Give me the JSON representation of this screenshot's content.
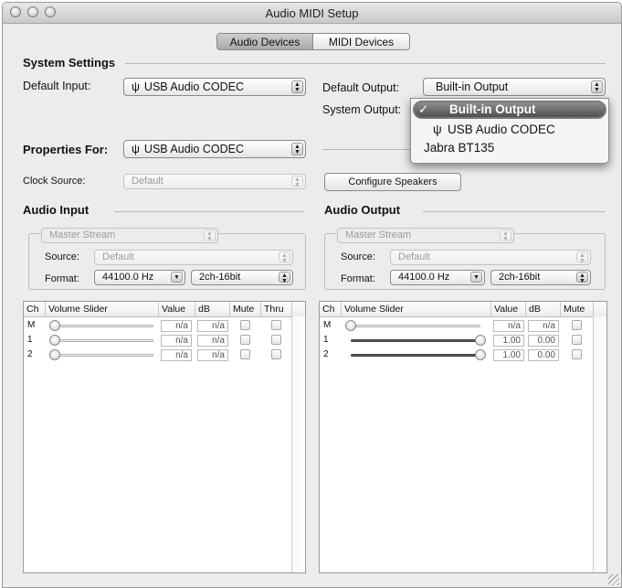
{
  "window": {
    "title": "Audio MIDI Setup"
  },
  "tabs": [
    {
      "label": "Audio Devices",
      "selected": true
    },
    {
      "label": "MIDI Devices",
      "selected": false
    }
  ],
  "system_settings": {
    "heading": "System Settings",
    "default_input_label": "Default Input:",
    "default_input_value": "USB Audio CODEC",
    "default_output_label": "Default Output:",
    "default_output_value": "Built-in Output",
    "system_output_label": "System Output:"
  },
  "output_menu": {
    "items": [
      {
        "label": "Built-in Output",
        "checked": true,
        "highlighted": true,
        "icon": "apple-icon"
      },
      {
        "label": "USB Audio CODEC",
        "checked": false,
        "highlighted": false,
        "icon": "usb-icon"
      },
      {
        "label": "Jabra BT135",
        "checked": false,
        "highlighted": false,
        "icon": ""
      }
    ],
    "check_mark": "✓"
  },
  "properties": {
    "label": "Properties For:",
    "value": "USB Audio CODEC",
    "clock_source_label": "Clock Source:",
    "clock_source_value": "Default",
    "configure_speakers_label": "Configure Speakers"
  },
  "audio_input": {
    "heading": "Audio Input",
    "stream": "Master Stream",
    "source_label": "Source:",
    "source_value": "Default",
    "format_label": "Format:",
    "format_rate": "44100.0 Hz",
    "format_bits": "2ch-16bit",
    "columns": [
      "Ch",
      "Volume Slider",
      "Value",
      "dB",
      "Mute",
      "Thru"
    ],
    "rows": [
      {
        "ch": "M",
        "value": "n/a",
        "db": "n/a",
        "level": 0
      },
      {
        "ch": "1",
        "value": "n/a",
        "db": "n/a",
        "level": 0
      },
      {
        "ch": "2",
        "value": "n/a",
        "db": "n/a",
        "level": 0
      }
    ]
  },
  "audio_output": {
    "heading": "Audio Output",
    "stream": "Master Stream",
    "source_label": "Source:",
    "source_value": "Default",
    "format_label": "Format:",
    "format_rate": "44100.0 Hz",
    "format_bits": "2ch-16bit",
    "columns": [
      "Ch",
      "Volume Slider",
      "Value",
      "dB",
      "Mute"
    ],
    "rows": [
      {
        "ch": "M",
        "value": "n/a",
        "db": "n/a",
        "level": 0
      },
      {
        "ch": "1",
        "value": "1.00",
        "db": "0.00",
        "level": 1
      },
      {
        "ch": "2",
        "value": "1.00",
        "db": "0.00",
        "level": 1
      }
    ]
  }
}
